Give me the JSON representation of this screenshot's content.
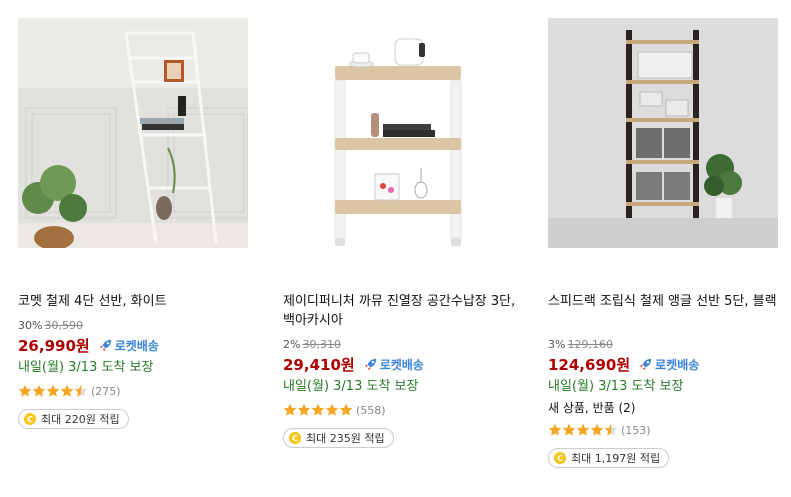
{
  "products": [
    {
      "title": "코멧 철제 4단 선반, 화이트",
      "discount": "30%",
      "original_price": "30,590",
      "price": "26,990원",
      "badge": "로켓배송",
      "delivery": "내일(월) 3/13 도착 보장",
      "extra": "",
      "rating": 4.5,
      "review_count": "(275)",
      "points": "최대 220원 적립"
    },
    {
      "title": "제이디퍼니처 까뮤 진열장 공간수납장 3단, 백아카시아",
      "discount": "2%",
      "original_price": "30,310",
      "price": "29,410원",
      "badge": "로켓배송",
      "delivery": "내일(월) 3/13 도착 보장",
      "extra": "",
      "rating": 5,
      "review_count": "(558)",
      "points": "최대 235원 적립"
    },
    {
      "title": "스피드랙 조립식 철제 앵글 선반 5단, 블랙",
      "discount": "3%",
      "original_price": "129,160",
      "price": "124,690원",
      "badge": "로켓배송",
      "delivery": "내일(월) 3/13 도착 보장",
      "extra": "새 상품, 반품 (2)",
      "rating": 4.5,
      "review_count": "(153)",
      "points": "최대 1,197원 적립"
    }
  ],
  "colors": {
    "price": "#ae0000",
    "rocket": "#3d84d8",
    "delivery": "#2a7a2a",
    "star": "#f5a623",
    "coin": "#f5c518"
  },
  "icons": {
    "rocket": "rocket-icon",
    "star": "star-icon",
    "coin": "coin-icon"
  }
}
